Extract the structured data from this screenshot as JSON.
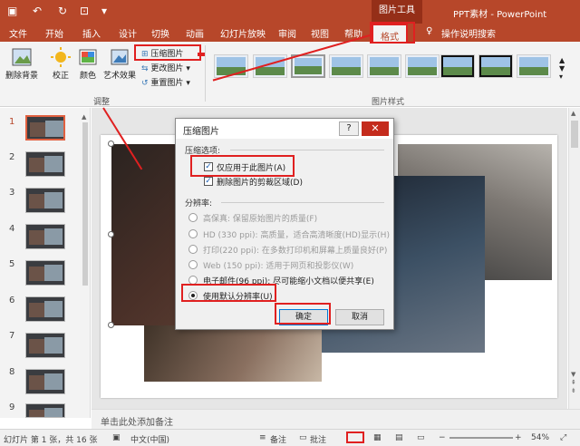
{
  "titlebar": {
    "context_tab_title": "图片工具",
    "doc_title": "PPT素材 - PowerPoint"
  },
  "tabs": [
    {
      "label": "文件"
    },
    {
      "label": "开始"
    },
    {
      "label": "插入"
    },
    {
      "label": "设计"
    },
    {
      "label": "切换"
    },
    {
      "label": "动画"
    },
    {
      "label": "幻灯片放映"
    },
    {
      "label": "审阅"
    },
    {
      "label": "视图"
    },
    {
      "label": "帮助"
    },
    {
      "label": "格式"
    },
    {
      "label": "操作说明搜索"
    }
  ],
  "ribbon": {
    "remove_bg": "删除背景",
    "correct": "校正",
    "color": "颜色",
    "art_effects": "艺术效果",
    "compress": "压缩图片",
    "change": "更改图片",
    "reset": "重置图片",
    "group_adjust": "调整",
    "group_styles": "图片样式"
  },
  "thumbnails": {
    "numbers": [
      "1",
      "2",
      "3",
      "4",
      "5",
      "6",
      "7",
      "8",
      "9"
    ]
  },
  "notes": {
    "placeholder": "单击此处添加备注"
  },
  "status": {
    "slide_info": "幻灯片 第 1 张，共 16 张",
    "language": "中文(中国)",
    "notes": "备注",
    "comments": "批注",
    "zoom": "54%"
  },
  "dialog": {
    "title": "压缩图片",
    "help": "?",
    "close": "✕",
    "options_label": "压缩选项:",
    "apply_only": "仅应用于此图片(A)",
    "delete_cropped": "删除图片的剪裁区域(D)",
    "resolution_label": "分辨率:",
    "resolutions": [
      "高保真: 保留原始图片的质量(F)",
      "HD (330 ppi): 高质量，适合高清晰度(HD)显示(H)",
      "打印(220 ppi): 在多数打印机和屏幕上质量良好(P)",
      "Web (150 ppi): 适用于网页和投影仪(W)",
      "电子邮件(96 ppi): 尽可能缩小文档以便共享(E)",
      "使用默认分辨率(U)"
    ],
    "ok": "确定",
    "cancel": "取消"
  }
}
